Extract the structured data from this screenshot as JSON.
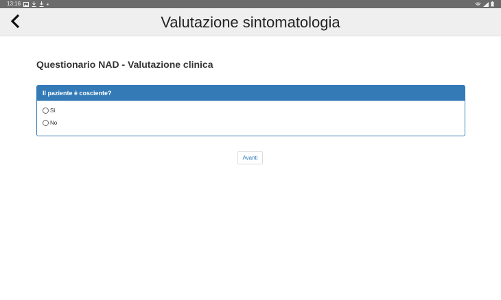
{
  "status_bar": {
    "time": "13:16",
    "icons_left": [
      "gallery-icon",
      "download-icon",
      "download-icon",
      "dot-icon"
    ],
    "icons_right": [
      "wifi-icon",
      "signal-icon",
      "battery-icon"
    ]
  },
  "app_bar": {
    "title": "Valutazione sintomatologia",
    "back_icon": "chevron-left-icon"
  },
  "questionnaire": {
    "title": "Questionario NAD - Valutazione clinica",
    "question": "Il paziente è cosciente?",
    "options": [
      {
        "label": "Sì",
        "selected": false
      },
      {
        "label": "No",
        "selected": false
      }
    ]
  },
  "actions": {
    "next_label": "Avanti"
  },
  "colors": {
    "primary": "#337ab7",
    "status_bar": "#6b6b6b",
    "app_bar": "#efefef"
  }
}
